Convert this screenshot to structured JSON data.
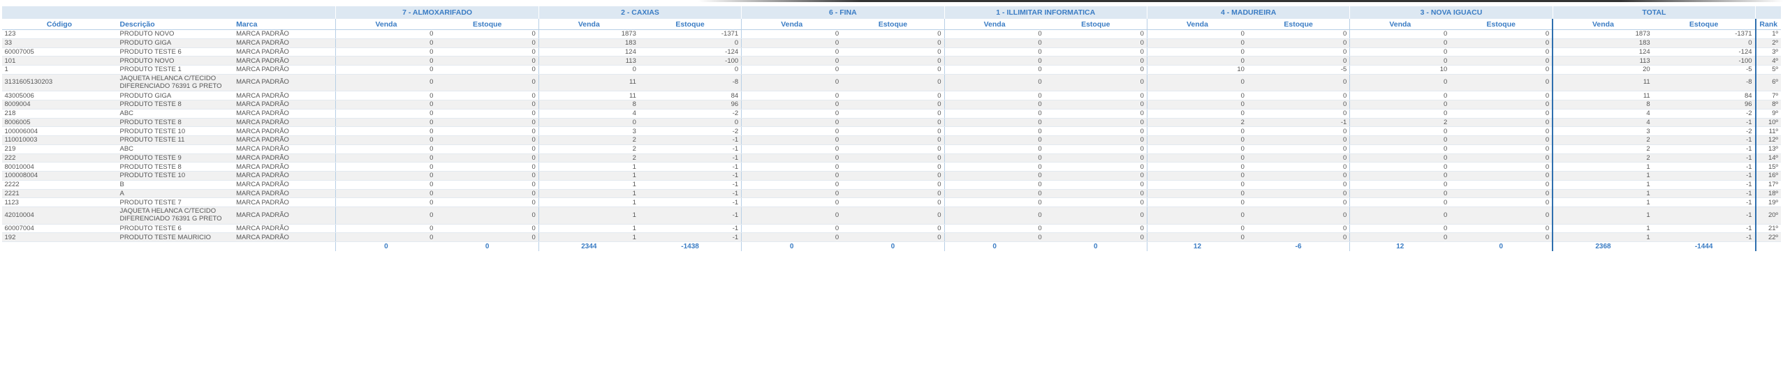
{
  "groups": [
    "7 - ALMOXARIFADO",
    "2 - CAXIAS",
    "6 - FINA",
    "1 - ILLIMITAR INFORMATICA",
    "4 - MADUREIRA",
    "3 - NOVA IGUACU",
    "TOTAL"
  ],
  "columns": {
    "codigo": "Código",
    "descricao": "Descrição",
    "marca": "Marca",
    "venda": "Venda",
    "estoque": "Estoque",
    "rank": "Rank"
  },
  "rows": [
    {
      "codigo": "123",
      "descricao": "PRODUTO NOVO",
      "marca": "MARCA PADRÃO",
      "values": [
        "0",
        "0",
        "1873",
        "-1371",
        "0",
        "0",
        "0",
        "0",
        "0",
        "0",
        "0",
        "0",
        "1873",
        "-1371"
      ],
      "rank": "1º"
    },
    {
      "codigo": "33",
      "descricao": "PRODUTO GIGA",
      "marca": "MARCA PADRÃO",
      "values": [
        "0",
        "0",
        "183",
        "0",
        "0",
        "0",
        "0",
        "0",
        "0",
        "0",
        "0",
        "0",
        "183",
        "0"
      ],
      "rank": "2º"
    },
    {
      "codigo": "60007005",
      "descricao": "PRODUTO TESTE 6",
      "marca": "MARCA PADRÃO",
      "values": [
        "0",
        "0",
        "124",
        "-124",
        "0",
        "0",
        "0",
        "0",
        "0",
        "0",
        "0",
        "0",
        "124",
        "-124"
      ],
      "rank": "3º"
    },
    {
      "codigo": "101",
      "descricao": "PRODUTO NOVO",
      "marca": "MARCA PADRÃO",
      "values": [
        "0",
        "0",
        "113",
        "-100",
        "0",
        "0",
        "0",
        "0",
        "0",
        "0",
        "0",
        "0",
        "113",
        "-100"
      ],
      "rank": "4º"
    },
    {
      "codigo": "1",
      "descricao": "PRODUTO TESTE 1",
      "marca": "MARCA PADRÃO",
      "values": [
        "0",
        "0",
        "0",
        "0",
        "0",
        "0",
        "0",
        "0",
        "10",
        "-5",
        "10",
        "0",
        "20",
        "-5"
      ],
      "rank": "5º"
    },
    {
      "codigo": "3131605130203",
      "descricao": "JAQUETA HELANCA C/TECIDO DIFERENCIADO 76391 G PRETO",
      "marca": "MARCA PADRÃO",
      "values": [
        "0",
        "0",
        "11",
        "-8",
        "0",
        "0",
        "0",
        "0",
        "0",
        "0",
        "0",
        "0",
        "11",
        "-8"
      ],
      "rank": "6º",
      "tall": true
    },
    {
      "codigo": "43005006",
      "descricao": "PRODUTO GIGA",
      "marca": "MARCA PADRÃO",
      "values": [
        "0",
        "0",
        "11",
        "84",
        "0",
        "0",
        "0",
        "0",
        "0",
        "0",
        "0",
        "0",
        "11",
        "84"
      ],
      "rank": "7º"
    },
    {
      "codigo": "8009004",
      "descricao": "PRODUTO TESTE 8",
      "marca": "MARCA PADRÃO",
      "values": [
        "0",
        "0",
        "8",
        "96",
        "0",
        "0",
        "0",
        "0",
        "0",
        "0",
        "0",
        "0",
        "8",
        "96"
      ],
      "rank": "8º"
    },
    {
      "codigo": "218",
      "descricao": "ABC",
      "marca": "MARCA PADRÃO",
      "values": [
        "0",
        "0",
        "4",
        "-2",
        "0",
        "0",
        "0",
        "0",
        "0",
        "0",
        "0",
        "0",
        "4",
        "-2"
      ],
      "rank": "9º"
    },
    {
      "codigo": "8006005",
      "descricao": "PRODUTO TESTE 8",
      "marca": "MARCA PADRÃO",
      "values": [
        "0",
        "0",
        "0",
        "0",
        "0",
        "0",
        "0",
        "0",
        "2",
        "-1",
        "2",
        "0",
        "4",
        "-1"
      ],
      "rank": "10º"
    },
    {
      "codigo": "100006004",
      "descricao": "PRODUTO TESTE 10",
      "marca": "MARCA PADRÃO",
      "values": [
        "0",
        "0",
        "3",
        "-2",
        "0",
        "0",
        "0",
        "0",
        "0",
        "0",
        "0",
        "0",
        "3",
        "-2"
      ],
      "rank": "11º"
    },
    {
      "codigo": "110010003",
      "descricao": "PRODUTO TESTE 11",
      "marca": "MARCA PADRÃO",
      "values": [
        "0",
        "0",
        "2",
        "-1",
        "0",
        "0",
        "0",
        "0",
        "0",
        "0",
        "0",
        "0",
        "2",
        "-1"
      ],
      "rank": "12º"
    },
    {
      "codigo": "219",
      "descricao": "ABC",
      "marca": "MARCA PADRÃO",
      "values": [
        "0",
        "0",
        "2",
        "-1",
        "0",
        "0",
        "0",
        "0",
        "0",
        "0",
        "0",
        "0",
        "2",
        "-1"
      ],
      "rank": "13º"
    },
    {
      "codigo": "222",
      "descricao": "PRODUTO TESTE 9",
      "marca": "MARCA PADRÃO",
      "values": [
        "0",
        "0",
        "2",
        "-1",
        "0",
        "0",
        "0",
        "0",
        "0",
        "0",
        "0",
        "0",
        "2",
        "-1"
      ],
      "rank": "14º"
    },
    {
      "codigo": "80010004",
      "descricao": "PRODUTO TESTE 8",
      "marca": "MARCA PADRÃO",
      "values": [
        "0",
        "0",
        "1",
        "-1",
        "0",
        "0",
        "0",
        "0",
        "0",
        "0",
        "0",
        "0",
        "1",
        "-1"
      ],
      "rank": "15º"
    },
    {
      "codigo": "100008004",
      "descricao": "PRODUTO TESTE 10",
      "marca": "MARCA PADRÃO",
      "values": [
        "0",
        "0",
        "1",
        "-1",
        "0",
        "0",
        "0",
        "0",
        "0",
        "0",
        "0",
        "0",
        "1",
        "-1"
      ],
      "rank": "16º"
    },
    {
      "codigo": "2222",
      "descricao": "B",
      "marca": "MARCA PADRÃO",
      "values": [
        "0",
        "0",
        "1",
        "-1",
        "0",
        "0",
        "0",
        "0",
        "0",
        "0",
        "0",
        "0",
        "1",
        "-1"
      ],
      "rank": "17º"
    },
    {
      "codigo": "2221",
      "descricao": "A",
      "marca": "MARCA PADRÃO",
      "values": [
        "0",
        "0",
        "1",
        "-1",
        "0",
        "0",
        "0",
        "0",
        "0",
        "0",
        "0",
        "0",
        "1",
        "-1"
      ],
      "rank": "18º"
    },
    {
      "codigo": "1123",
      "descricao": "PRODUTO TESTE 7",
      "marca": "MARCA PADRÃO",
      "values": [
        "0",
        "0",
        "1",
        "-1",
        "0",
        "0",
        "0",
        "0",
        "0",
        "0",
        "0",
        "0",
        "1",
        "-1"
      ],
      "rank": "19º"
    },
    {
      "codigo": "42010004",
      "descricao": "JAQUETA HELANCA C/TECIDO DIFERENCIADO 76391 G PRETO",
      "marca": "MARCA PADRÃO",
      "values": [
        "0",
        "0",
        "1",
        "-1",
        "0",
        "0",
        "0",
        "0",
        "0",
        "0",
        "0",
        "0",
        "1",
        "-1"
      ],
      "rank": "20º",
      "tall": true
    },
    {
      "codigo": "60007004",
      "descricao": "PRODUTO TESTE 6",
      "marca": "MARCA PADRÃO",
      "values": [
        "0",
        "0",
        "1",
        "-1",
        "0",
        "0",
        "0",
        "0",
        "0",
        "0",
        "0",
        "0",
        "1",
        "-1"
      ],
      "rank": "21º"
    },
    {
      "codigo": "192",
      "descricao": "PRODUTO TESTE MAURICIO",
      "marca": "MARCA PADRÃO",
      "values": [
        "0",
        "0",
        "1",
        "-1",
        "0",
        "0",
        "0",
        "0",
        "0",
        "0",
        "0",
        "0",
        "1",
        "-1"
      ],
      "rank": "22º"
    }
  ],
  "totals": [
    "0",
    "0",
    "2344",
    "-1438",
    "0",
    "0",
    "0",
    "0",
    "12",
    "-6",
    "12",
    "0",
    "2368",
    "-1444"
  ],
  "colors": {
    "accent": "#3a7cc4",
    "header_bg": "#dde8f2",
    "total_border": "#2f6fae"
  }
}
